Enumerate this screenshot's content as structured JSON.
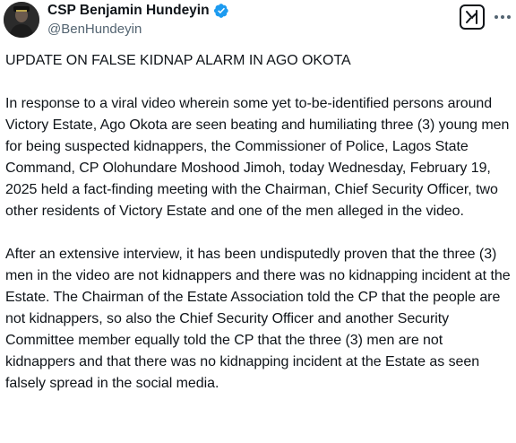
{
  "author": {
    "display_name": "CSP Benjamin Hundeyin",
    "handle": "@BenHundeyin",
    "verified": true,
    "verified_color": "#1d9bf0"
  },
  "icons": {
    "verified": "verified-badge-icon",
    "grok": "grok-icon",
    "more": "more-options-icon"
  },
  "tweet": {
    "headline": "UPDATE ON FALSE KIDNAP ALARM IN AGO OKOTA",
    "paragraph_1": "In response to a viral video wherein some yet to-be-identified persons around Victory Estate, Ago Okota are seen beating and humiliating three (3) young men for being suspected kidnappers, the Commissioner of Police, Lagos State Command, CP Olohundare Moshood Jimoh, today Wednesday, February 19, 2025 held a fact-finding meeting with the Chairman, Chief Security Officer, two other residents of Victory Estate and one of the men alleged in the video.",
    "paragraph_2": "After an extensive interview, it has been undisputedly proven that the three (3) men in the video are not kidnappers and there was no kidnapping incident at the Estate. The Chairman of the Estate Association told the CP that the people are not kidnappers, so also the Chief Security Officer and another Security Committee member equally told the CP that the three (3) men are not kidnappers and that there was no kidnapping incident at the Estate as seen falsely spread in the social media."
  }
}
